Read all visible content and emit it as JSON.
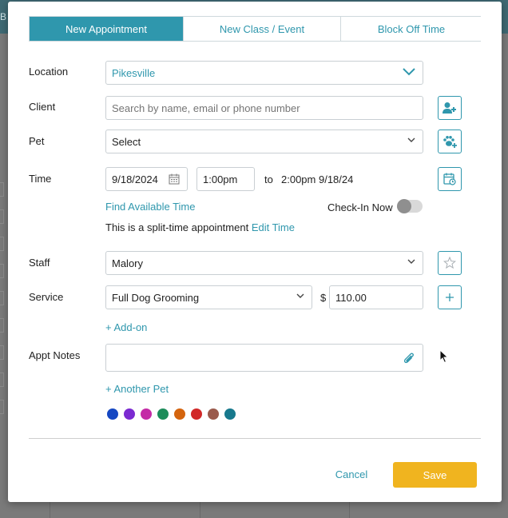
{
  "background": {
    "letter": "B"
  },
  "tabs": [
    {
      "label": "New Appointment",
      "active": true
    },
    {
      "label": "New Class / Event",
      "active": false
    },
    {
      "label": "Block Off Time",
      "active": false
    }
  ],
  "location": {
    "label": "Location",
    "value": "Pikesville"
  },
  "client": {
    "label": "Client",
    "placeholder": "Search by name, email or phone number",
    "add_icon": "add-client-icon"
  },
  "pet": {
    "label": "Pet",
    "value": "Select",
    "add_icon": "add-pet-icon"
  },
  "time": {
    "label": "Time",
    "date": "9/18/2024",
    "start": "1:00pm",
    "to_label": "to",
    "end": "2:00pm 9/18/24",
    "find_available": "Find Available Time",
    "checkin_label": "Check-In Now",
    "checkin_on": false,
    "split_text": "This is a split-time appointment",
    "edit_time": "Edit Time"
  },
  "staff": {
    "label": "Staff",
    "value": "Malory"
  },
  "service": {
    "label": "Service",
    "value": "Full Dog Grooming",
    "currency": "$",
    "price": "110.00",
    "add_on": "+ Add-on"
  },
  "notes": {
    "label": "Appt Notes",
    "value": ""
  },
  "another_pet": "+ Another Pet",
  "colors": [
    "#1547c2",
    "#7b2ad1",
    "#c42aa6",
    "#1d8c5a",
    "#d4640e",
    "#d12828",
    "#9a5a4c",
    "#17798d"
  ],
  "actions": {
    "cancel": "Cancel",
    "save": "Save"
  },
  "accent": "#2f97ad",
  "save_color": "#f0b41f"
}
